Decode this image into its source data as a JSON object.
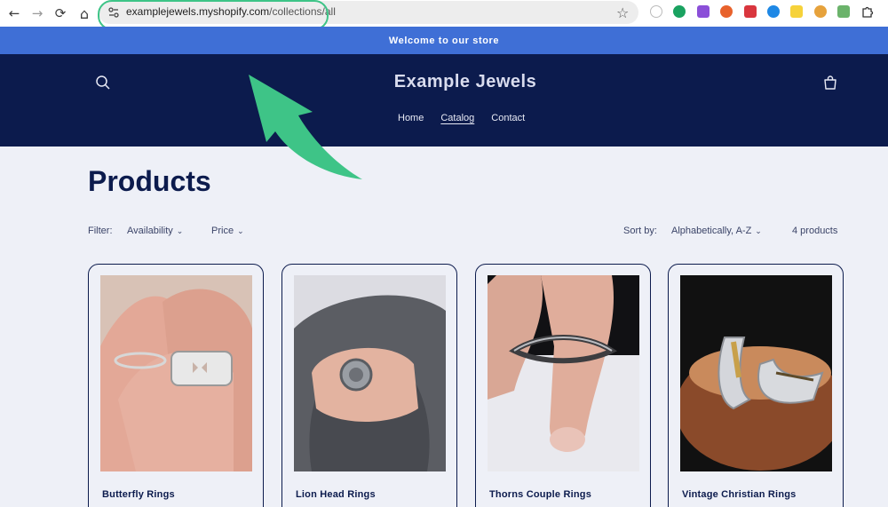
{
  "browser": {
    "url_domain": "examplejewels.myshopify.com",
    "url_path": "/collections/all",
    "back_glyph": "←",
    "forward_glyph": "→",
    "reload_glyph": "⟳",
    "home_glyph": "⌂",
    "star_glyph": "☆"
  },
  "announcement": {
    "text": "Welcome to our store"
  },
  "header": {
    "brand": "Example Jewels",
    "menu": [
      {
        "label": "Home"
      },
      {
        "label": "Catalog"
      },
      {
        "label": "Contact"
      }
    ]
  },
  "collection": {
    "title": "Products",
    "filter_label": "Filter:",
    "filters": [
      {
        "label": "Availability"
      },
      {
        "label": "Price"
      }
    ],
    "sort_label": "Sort by:",
    "sort_value": "Alphabetically, A-Z",
    "count": "4 products"
  },
  "products": [
    {
      "name": "Butterfly Rings"
    },
    {
      "name": "Lion Head Rings"
    },
    {
      "name": "Thorns Couple Rings"
    },
    {
      "name": "Vintage Christian Rings"
    }
  ],
  "colors": {
    "announcement_bg": "#3f6fd6",
    "header_bg": "#0c1b4d",
    "page_bg": "#eef0f7",
    "annotation": "#3ec487"
  }
}
